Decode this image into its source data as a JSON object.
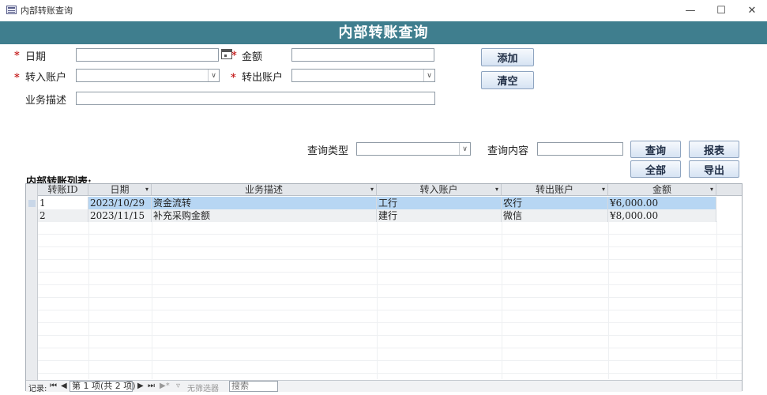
{
  "window": {
    "title": "内部转账查询",
    "minimize": "—",
    "maximize": "☐",
    "close": "✕"
  },
  "header": {
    "title": "内部转账查询"
  },
  "form": {
    "required_mark": "*",
    "date_label": "日期",
    "date_value": "",
    "amount_label": "金额",
    "amount_value": "",
    "in_account_label": "转入账户",
    "in_account_value": "",
    "out_account_label": "转出账户",
    "out_account_value": "",
    "desc_label": "业务描述",
    "desc_value": ""
  },
  "buttons": {
    "add": "添加",
    "clear": "清空",
    "query": "查询",
    "report": "报表",
    "all": "全部",
    "export": "导出"
  },
  "search": {
    "type_label": "查询类型",
    "type_value": "",
    "content_label": "查询内容",
    "content_value": ""
  },
  "list": {
    "title": "内部转账列表:",
    "columns": [
      "转账ID",
      "日期",
      "业务描述",
      "转入账户",
      "转出账户",
      "金额"
    ],
    "rows": [
      {
        "id": "1",
        "date": "2023/10/29",
        "desc": "资金流转",
        "in": "工行",
        "out": "农行",
        "amount": "¥6,000.00",
        "selected": true
      },
      {
        "id": "2",
        "date": "2023/11/15",
        "desc": "补充采购金额",
        "in": "建行",
        "out": "微信",
        "amount": "¥8,000.00",
        "selected": false
      }
    ]
  },
  "navbar": {
    "record_label": "记录:",
    "first": "⏮",
    "prev": "◀",
    "position": "第 1 项(共 2 项)",
    "next": "▶",
    "last": "⏭",
    "new": "▶*",
    "filter": "无筛选器",
    "search_placeholder": "搜索"
  },
  "icons": {
    "app": "form-icon",
    "calendar": "calendar-icon",
    "dropdown": "chevron-down-icon",
    "filter": "funnel-icon"
  },
  "colors": {
    "header_band": "#3f7e8e",
    "selected_row": "#b7d6f3",
    "required": "#c41a1a"
  }
}
